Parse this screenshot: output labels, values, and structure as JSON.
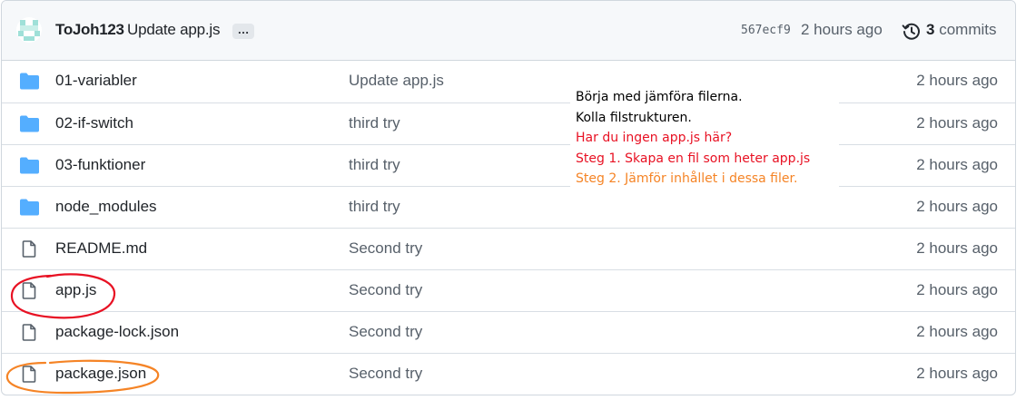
{
  "latest_commit": {
    "author": "ToJoh123",
    "message": "Update app.js",
    "ellipsis": "…",
    "sha": "567ecf9",
    "time": "2 hours ago",
    "commits_count": "3",
    "commits_label": "commits"
  },
  "files": [
    {
      "type": "folder",
      "name": "01-variabler",
      "commit": "Update app.js",
      "time": "2 hours ago"
    },
    {
      "type": "folder",
      "name": "02-if-switch",
      "commit": "third try",
      "time": "2 hours ago"
    },
    {
      "type": "folder",
      "name": "03-funktioner",
      "commit": "third try",
      "time": "2 hours ago"
    },
    {
      "type": "folder",
      "name": "node_modules",
      "commit": "third try",
      "time": "2 hours ago"
    },
    {
      "type": "file",
      "name": "README.md",
      "commit": "Second try",
      "time": "2 hours ago"
    },
    {
      "type": "file",
      "name": "app.js",
      "commit": "Second try",
      "time": "2 hours ago"
    },
    {
      "type": "file",
      "name": "package-lock.json",
      "commit": "Second try",
      "time": "2 hours ago"
    },
    {
      "type": "file",
      "name": "package.json",
      "commit": "Second try",
      "time": "2 hours ago"
    }
  ],
  "note": {
    "lines": [
      "Börja med jämföra filerna.",
      "Kolla filstrukturen.",
      "Har du ingen app.js här?",
      "Steg 1. Skapa en fil som heter app.js",
      "Steg 2. Jämför inhållet i dessa filer."
    ],
    "colors": {
      "plain": "#000000",
      "warning": "#e81123",
      "step2": "#f58426"
    }
  },
  "colors": {
    "folder": "#54aeff",
    "file_icon": "#57606a",
    "annotation_red": "#e81123",
    "annotation_orange": "#f58426"
  }
}
